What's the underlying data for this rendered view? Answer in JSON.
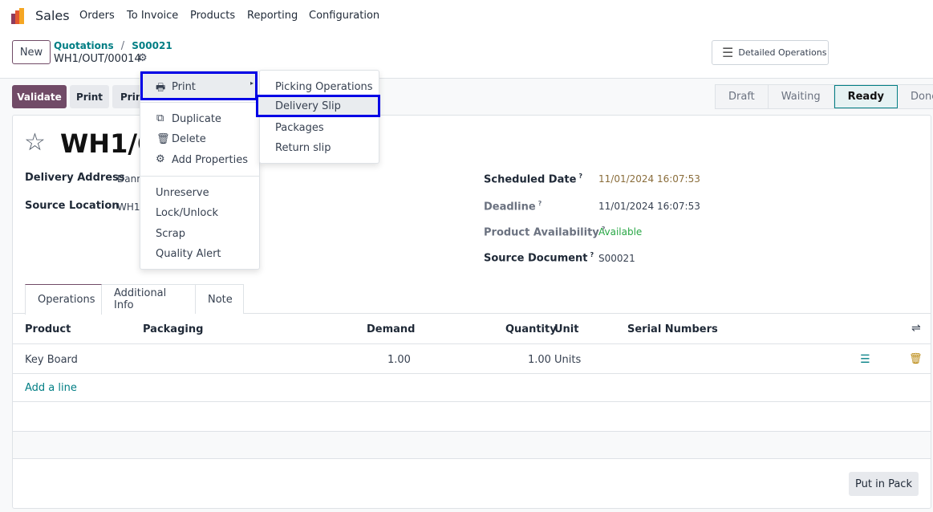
{
  "nav": {
    "app": "Sales",
    "items": [
      "Orders",
      "To Invoice",
      "Products",
      "Reporting",
      "Configuration"
    ]
  },
  "control": {
    "new_label": "New",
    "breadcrumb": [
      "Quotations",
      "S00021"
    ],
    "record": "WH1/OUT/00014",
    "detailed_ops": "Detailed Operations"
  },
  "buttons": {
    "validate": "Validate",
    "print": "Print",
    "print2": "Prin"
  },
  "statusbar": {
    "stages": [
      "Draft",
      "Waiting",
      "Ready",
      "Done"
    ],
    "active": "Ready"
  },
  "form": {
    "title": "WH1/O",
    "delivery_address_label": "Delivery Address",
    "delivery_address": "Dann",
    "source_location_label": "Source Location",
    "source_location": "WH1",
    "scheduled_date_label": "Scheduled Date",
    "scheduled_date": "11/01/2024 16:07:53",
    "deadline_label": "Deadline",
    "deadline": "11/01/2024 16:07:53",
    "availability_label": "Product Availability",
    "availability": "Available",
    "source_doc_label": "Source Document",
    "source_doc": "S00021",
    "help": "?"
  },
  "tabs": [
    "Operations",
    "Additional Info",
    "Note"
  ],
  "table": {
    "headers": [
      "Product",
      "Packaging",
      "Demand",
      "Quantity",
      "Unit",
      "Serial Numbers"
    ],
    "rows": [
      {
        "product": "Key Board",
        "demand": "1.00",
        "quantity": "1.00",
        "unit": "Units"
      }
    ],
    "add_line": "Add a line"
  },
  "put_in_pack": "Put in Pack",
  "action_menu": {
    "print": "Print",
    "items": [
      "Duplicate",
      "Delete",
      "Add Properties"
    ],
    "items2": [
      "Unreserve",
      "Lock/Unlock",
      "Scrap",
      "Quality Alert"
    ]
  },
  "print_submenu": {
    "items": [
      "Picking Operations",
      "Delivery Slip",
      "Packages",
      "Return slip"
    ],
    "highlighted": "Delivery Slip"
  },
  "colors": {
    "brand": "#714b67",
    "link": "#017e84",
    "highlight": "#0000e6",
    "available": "#28a745",
    "date": "#8a6d3b"
  }
}
